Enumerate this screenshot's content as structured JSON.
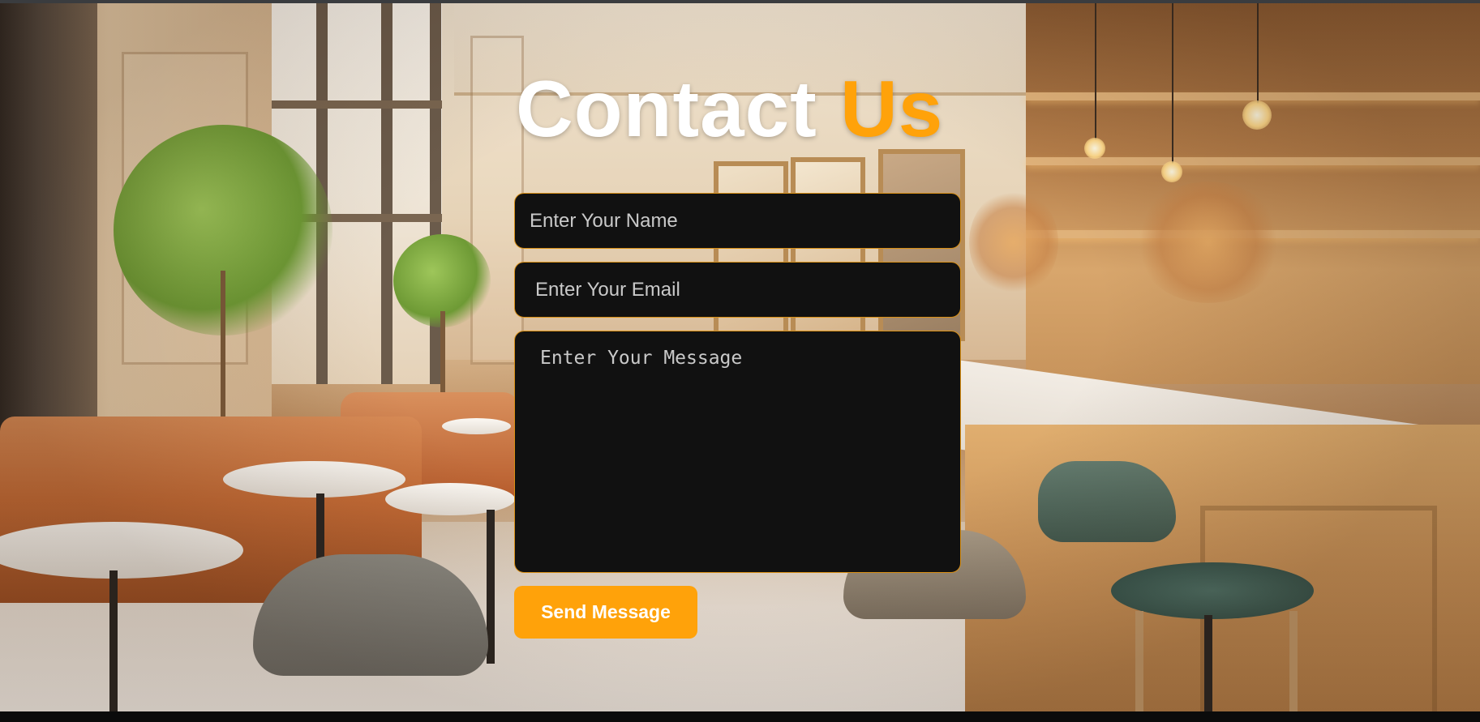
{
  "heading": {
    "word_primary": "Contact",
    "word_accent": "Us"
  },
  "form": {
    "name_placeholder": "Enter Your Name",
    "email_placeholder": "Enter Your Email",
    "message_placeholder": "Enter Your Message",
    "name_value": "",
    "email_value": "",
    "message_value": "",
    "submit_label": "Send Message"
  },
  "colors": {
    "accent": "#ffa20a",
    "heading_primary": "#ffffff",
    "field_background": "#111111",
    "field_border": "#d98f14",
    "placeholder_text": "#c9c9c9"
  },
  "background": {
    "subject": "cafe-interior-photo"
  }
}
